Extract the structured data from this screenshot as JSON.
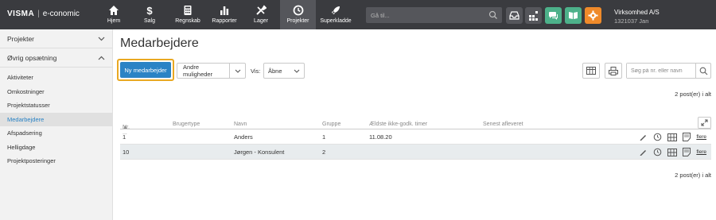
{
  "brand": {
    "logo": "VISMA",
    "product": "e-conomic"
  },
  "nav": [
    {
      "label": "Hjem",
      "icon": "home-icon"
    },
    {
      "label": "Salg",
      "icon": "dollar-icon"
    },
    {
      "label": "Regnskab",
      "icon": "calculator-icon"
    },
    {
      "label": "Rapporter",
      "icon": "bar-chart-icon"
    },
    {
      "label": "Lager",
      "icon": "tools-icon"
    },
    {
      "label": "Projekter",
      "icon": "clock-icon",
      "active": true
    },
    {
      "label": "Superkladde",
      "icon": "rocket-icon"
    }
  ],
  "search": {
    "placeholder": "Gå til..."
  },
  "company": {
    "name": "Virksomhed A/S",
    "sub": "1321037 Jan"
  },
  "sidebar": {
    "sections": [
      {
        "label": "Projekter",
        "expanded": false
      },
      {
        "label": "Øvrig opsætning",
        "expanded": true
      }
    ],
    "items": [
      {
        "label": "Aktiviteter"
      },
      {
        "label": "Omkostninger"
      },
      {
        "label": "Projektstatusser"
      },
      {
        "label": "Medarbejdere",
        "active": true
      },
      {
        "label": "Afspadsering"
      },
      {
        "label": "Helligdage"
      },
      {
        "label": "Projektposteringer"
      }
    ]
  },
  "page": {
    "title": "Medarbejdere",
    "new_button": "Ny medarbejder",
    "more_button": "Andre muligheder",
    "vis_label": "Vis:",
    "vis_value": "Åbne",
    "search_placeholder": "Søg på nr. eller navn",
    "count_top": "2 post(er) i alt",
    "count_bottom": "2 post(er) i alt"
  },
  "table": {
    "columns": [
      "Nr.",
      "Brugertype",
      "Navn",
      "Gruppe",
      "Ældste ikke-godk. timer",
      "Senest afleveret"
    ],
    "rows": [
      {
        "nr": "1",
        "brugertype": "",
        "navn": "Anders",
        "gruppe": "1",
        "aeldste": "11.08.20",
        "senest": ""
      },
      {
        "nr": "10",
        "brugertype": "",
        "navn": "Jørgen - Konsulent",
        "gruppe": "2",
        "aeldste": "",
        "senest": ""
      }
    ],
    "row_link": "flere"
  },
  "colors": {
    "topbar": "#3a3b3f",
    "accent_blue": "#2a83c5",
    "highlight": "#e9a822",
    "green": "#4db18a",
    "orange": "#ef8a2a"
  }
}
